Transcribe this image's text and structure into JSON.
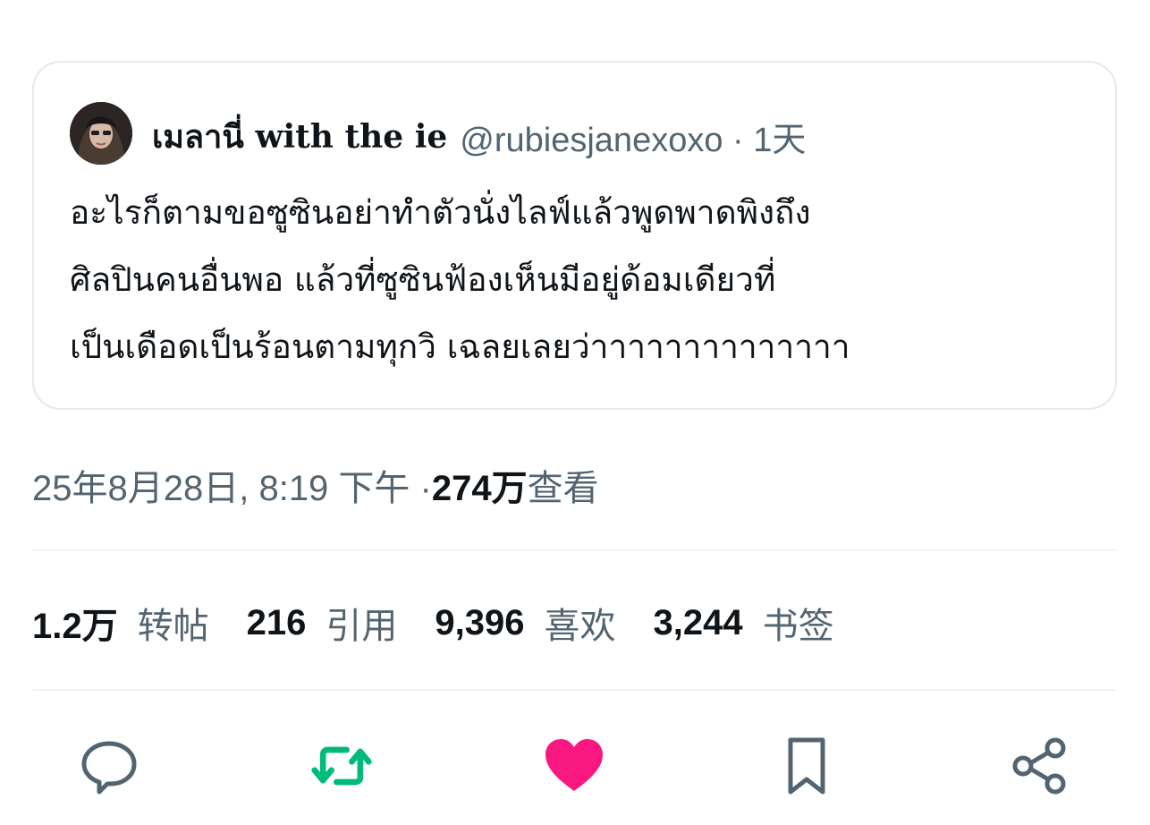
{
  "quote": {
    "author_name": "เมลานี่ with the ie",
    "author_handle": "@rubiesjanexoxo · 1天",
    "text_lines": [
      "อะไรก็ตามขอซูซินอย่าทำตัวนั่งไลฟ์แล้วพูดพาดพิงถึง",
      "ศิลปินคนอื่นพอ แล้วที่ซูซินฟ้องเห็นมีอยู่ด้อมเดียวที่",
      "เป็นเดือดเป็นร้อนตามทุกวิ เฉลยเลยว่าาาาาาาาาาาาาา"
    ]
  },
  "meta": {
    "datetime": "25年8月28日, 8:19 下午 · ",
    "views_count": "274万",
    "views_label": " 查看"
  },
  "stats": [
    {
      "count": "1.2万",
      "label": "转帖"
    },
    {
      "count": "216",
      "label": "引用"
    },
    {
      "count": "9,396",
      "label": "喜欢"
    },
    {
      "count": "3,244",
      "label": "书签"
    }
  ],
  "actions": {
    "reply_icon": "reply-icon",
    "retweet_icon": "retweet-icon",
    "like_icon": "heart-icon",
    "bookmark_icon": "bookmark-icon",
    "share_icon": "share-icon"
  },
  "colors": {
    "retweet": "#00ba7c",
    "like": "#f91880",
    "icon": "#536471"
  }
}
